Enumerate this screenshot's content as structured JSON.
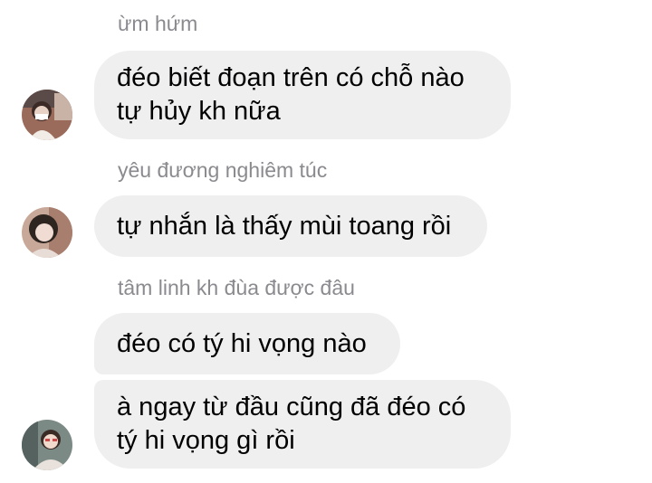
{
  "messages": [
    {
      "sender_name": "ừm hứm",
      "bubbles": [
        "đéo biết đoạn trên có chỗ nào\ntự hủy kh nữa"
      ],
      "avatar_icon": "user-avatar-photo"
    },
    {
      "sender_name": "yêu đương nghiêm túc",
      "bubbles": [
        "tự nhắn là thấy mùi toang rồi"
      ],
      "avatar_icon": "user-avatar-photo"
    },
    {
      "sender_name": "tâm linh kh đùa được đâu",
      "bubbles": [
        "đéo có tý hi vọng nào",
        "à ngay từ đầu cũng đã đéo có\ntý hi vọng gì rồi"
      ],
      "avatar_icon": "user-avatar-photo"
    }
  ],
  "colors": {
    "bubble_background": "#efeff0",
    "sender_name_text": "#8a8a8f",
    "message_text": "#000000",
    "background": "#ffffff"
  }
}
